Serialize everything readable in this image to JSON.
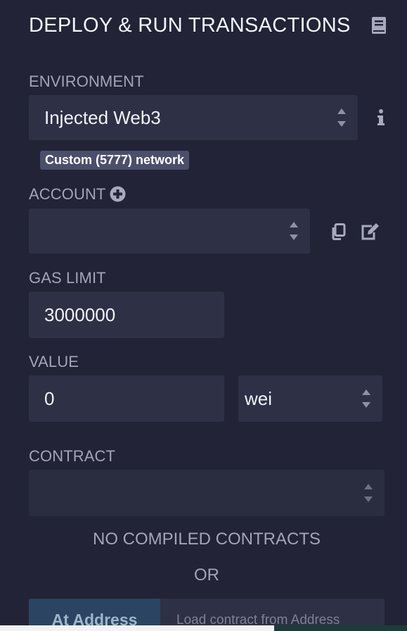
{
  "header": {
    "title": "DEPLOY & RUN TRANSACTIONS",
    "doc_icon": "book-icon"
  },
  "environment": {
    "label": "ENVIRONMENT",
    "selected": "Injected Web3",
    "info_icon": "info-icon",
    "network_badge": "Custom (5777) network"
  },
  "account": {
    "label": "ACCOUNT",
    "add_icon": "plus-circle-icon",
    "selected": "",
    "copy_icon": "copy-icon",
    "edit_icon": "edit-icon"
  },
  "gas_limit": {
    "label": "GAS LIMIT",
    "value": "3000000"
  },
  "value": {
    "label": "VALUE",
    "amount": "0",
    "unit": "wei"
  },
  "contract": {
    "label": "CONTRACT",
    "selected": "",
    "empty_message": "NO COMPILED CONTRACTS",
    "or_text": "OR"
  },
  "at_address": {
    "button_label": "At Address",
    "placeholder": "Load contract from Address"
  },
  "colors": {
    "background": "#222336",
    "field": "#2e3046",
    "badge": "#4c4f6a",
    "at_address_button": "#2a4462"
  }
}
